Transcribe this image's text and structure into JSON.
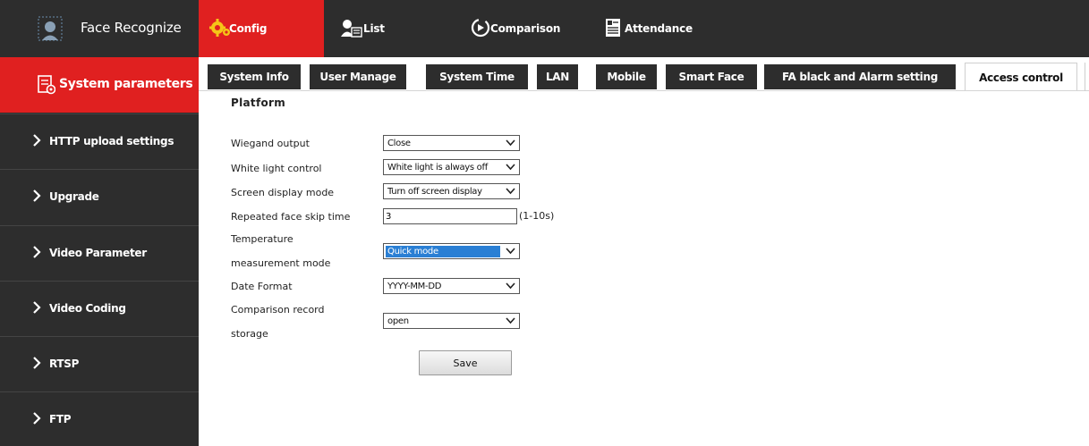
{
  "app": {
    "title": "Face Recognize",
    "brand_icon": "face-scan-icon"
  },
  "topnav": {
    "items": [
      {
        "label": "Config",
        "icon": "gear-icon",
        "active": true
      },
      {
        "label": "List",
        "icon": "person-list-icon",
        "active": false
      },
      {
        "label": "Comparison",
        "icon": "comparison-icon",
        "active": false
      },
      {
        "label": "Attendance",
        "icon": "attendance-icon",
        "active": false
      }
    ]
  },
  "sidebar": {
    "active_label": "System parameters",
    "items": [
      {
        "label": "HTTP upload settings"
      },
      {
        "label": "Upgrade"
      },
      {
        "label": "Video Parameter"
      },
      {
        "label": "Video Coding"
      },
      {
        "label": "RTSP"
      },
      {
        "label": "FTP"
      }
    ]
  },
  "tabs": [
    {
      "label": "System Info"
    },
    {
      "label": "User Manage"
    },
    {
      "label": "System Time"
    },
    {
      "label": "LAN"
    },
    {
      "label": "Mobile"
    },
    {
      "label": "Smart Face"
    },
    {
      "label": "FA black and Alarm setting"
    },
    {
      "label": "Access control",
      "active": true
    }
  ],
  "form": {
    "section_title": "Platform",
    "fields": {
      "wiegand": {
        "label": "Wiegand output",
        "value": "Close"
      },
      "white_light": {
        "label": "White light control",
        "value": "White light is always off"
      },
      "screen_display": {
        "label": "Screen display mode",
        "value": "Turn off screen display"
      },
      "skip_time": {
        "label": "Repeated face skip time",
        "value": "3",
        "hint": "(1-10s)"
      },
      "temperature": {
        "label_line1": "Temperature",
        "label_line2": "measurement mode",
        "value": "Quick mode"
      },
      "date_format": {
        "label": "Date Format",
        "value": "YYYY-MM-DD"
      },
      "comparison_storage": {
        "label_line1": "Comparison record",
        "label_line2": "storage",
        "value": "open"
      }
    },
    "save_label": "Save"
  },
  "colors": {
    "accent_red": "#e02020",
    "dark_bg": "#2d2d2d",
    "select_highlight": "#2a7fd4"
  }
}
